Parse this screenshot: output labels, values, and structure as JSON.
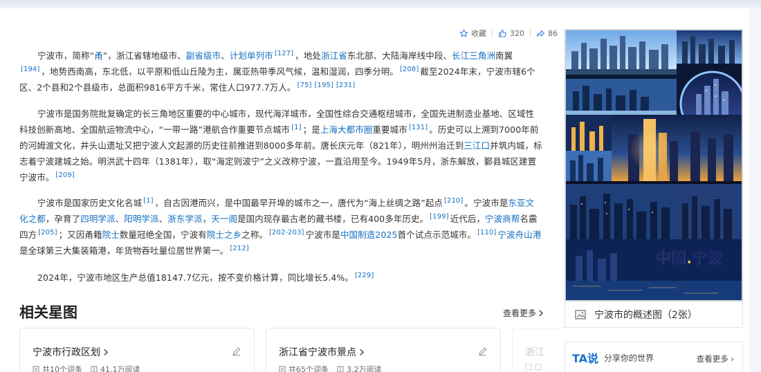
{
  "actions": {
    "collect_label": "收藏",
    "like_count": "320",
    "share_count": "86"
  },
  "paragraphs": {
    "p1": {
      "a": "宁波市，简称“",
      "l1": "甬",
      "b": "”，浙江省辖地级市、",
      "l2": "副省级市",
      "c": "、",
      "l3": "计划单列市",
      "s1": "[127]",
      "d": "，地处",
      "l4": "浙江省",
      "e": "东北部、大陆海岸线中段、",
      "l5": "长江三角洲",
      "f": "南翼",
      "s2": "[194]",
      "g": "，地势西南高，东北低，以平原和低山丘陵为主，属亚热带季风气候，温和湿润，四季分明。",
      "s3": "[208]",
      "h": "截至2024年末，宁波市辖6个区、2个县和2个县级市，总面积9816平方千米，常住人口977.7万人。",
      "s4": "[75]",
      "s5": "[195]",
      "s6": "[231]"
    },
    "p2": {
      "a": "宁波市是国务院批复确定的长三角地区重要的中心城市，现代海洋城市，全国性综合交通枢纽城市，全国先进制造业基地、区域性科技创新高地、全国航运物流中心，“一带一路”港航合作重要节点城市",
      "s1": "[1]",
      "b": "；是",
      "l1": "上海大都市圈",
      "c": "重要城市",
      "s2": "[131]",
      "d": "。历史可以上溯到7000年前的河姆渡文化，井头山遗址又把宁波人文起源的历史往前推进到8000多年前。唐长庆元年（821年），明州州治迁到",
      "l2": "三江口",
      "e": "并筑内城，标志着宁波建城之始。明洪武十四年（1381年），取“海定则波宁”之义改称宁波，一直沿用至今。1949年5月，浙东解放，鄞县城区建置宁波市。",
      "s3": "[209]"
    },
    "p3": {
      "a": "宁波市是国家历史文化名城",
      "s1": "[1]",
      "b": "，自古因港而兴，是中国最早开埠的城市之一，唐代为“海上丝绸之路”起点",
      "s2": "[210]",
      "c": "。宁波市是",
      "l1": "东亚文化之都",
      "d": "，孕育了",
      "l2": "四明学派",
      "e": "、",
      "l3": "阳明学派",
      "f": "、",
      "l4": "浙东学派",
      "g": "，",
      "l5": "天一阁",
      "h": "是国内现存最古老的藏书楼，已有400多年历史。",
      "s3": "[199]",
      "i": "近代后，",
      "l6": "宁波商帮",
      "j": "名震四方",
      "s4": "[205]",
      "k": "；又因甬籍",
      "l7": "院士",
      "m": "数量冠绝全国，宁波有",
      "l8": "院士之乡",
      "n": "之称。",
      "s5": "[202-203]",
      "o": "宁波市是",
      "l9": "中国制造2025",
      "p": "首个试点示范城市。",
      "s6": "[110]",
      "l10": "宁波舟山港",
      "q": "是全球第三大集装箱港，年货物吞吐量位居世界第一。",
      "s7": "[212]"
    },
    "p4": {
      "a": "2024年，宁波市地区生产总值18147.7亿元，按不变价格计算，同比增长5.4%。",
      "s1": "[229]"
    }
  },
  "related": {
    "title": "相关星图",
    "more": "查看更多",
    "cards": [
      {
        "title": "宁波市行政区划",
        "entries": "共10个词条",
        "reads": "41.1万阅读"
      },
      {
        "title": "浙江省宁波市景点",
        "entries": "共65个词条",
        "reads": "3.2万阅读"
      },
      {
        "title": "浙江"
      }
    ]
  },
  "sidebar": {
    "hero_overlay": "中国.宁波",
    "caption": "宁波市的概述图（2张）",
    "ta_logo": "TA说",
    "ta_slogan": "分享你的世界",
    "ta_more": "查看更多"
  },
  "colors": {
    "link": "#136ec2",
    "text": "#333333",
    "overlay_text": "#ffe23a"
  },
  "icons": [
    "star-icon",
    "thumbs-up-icon",
    "share-icon",
    "chevron-right-icon",
    "pen-icon",
    "list-icon",
    "book-icon",
    "image-gallery-icon"
  ]
}
